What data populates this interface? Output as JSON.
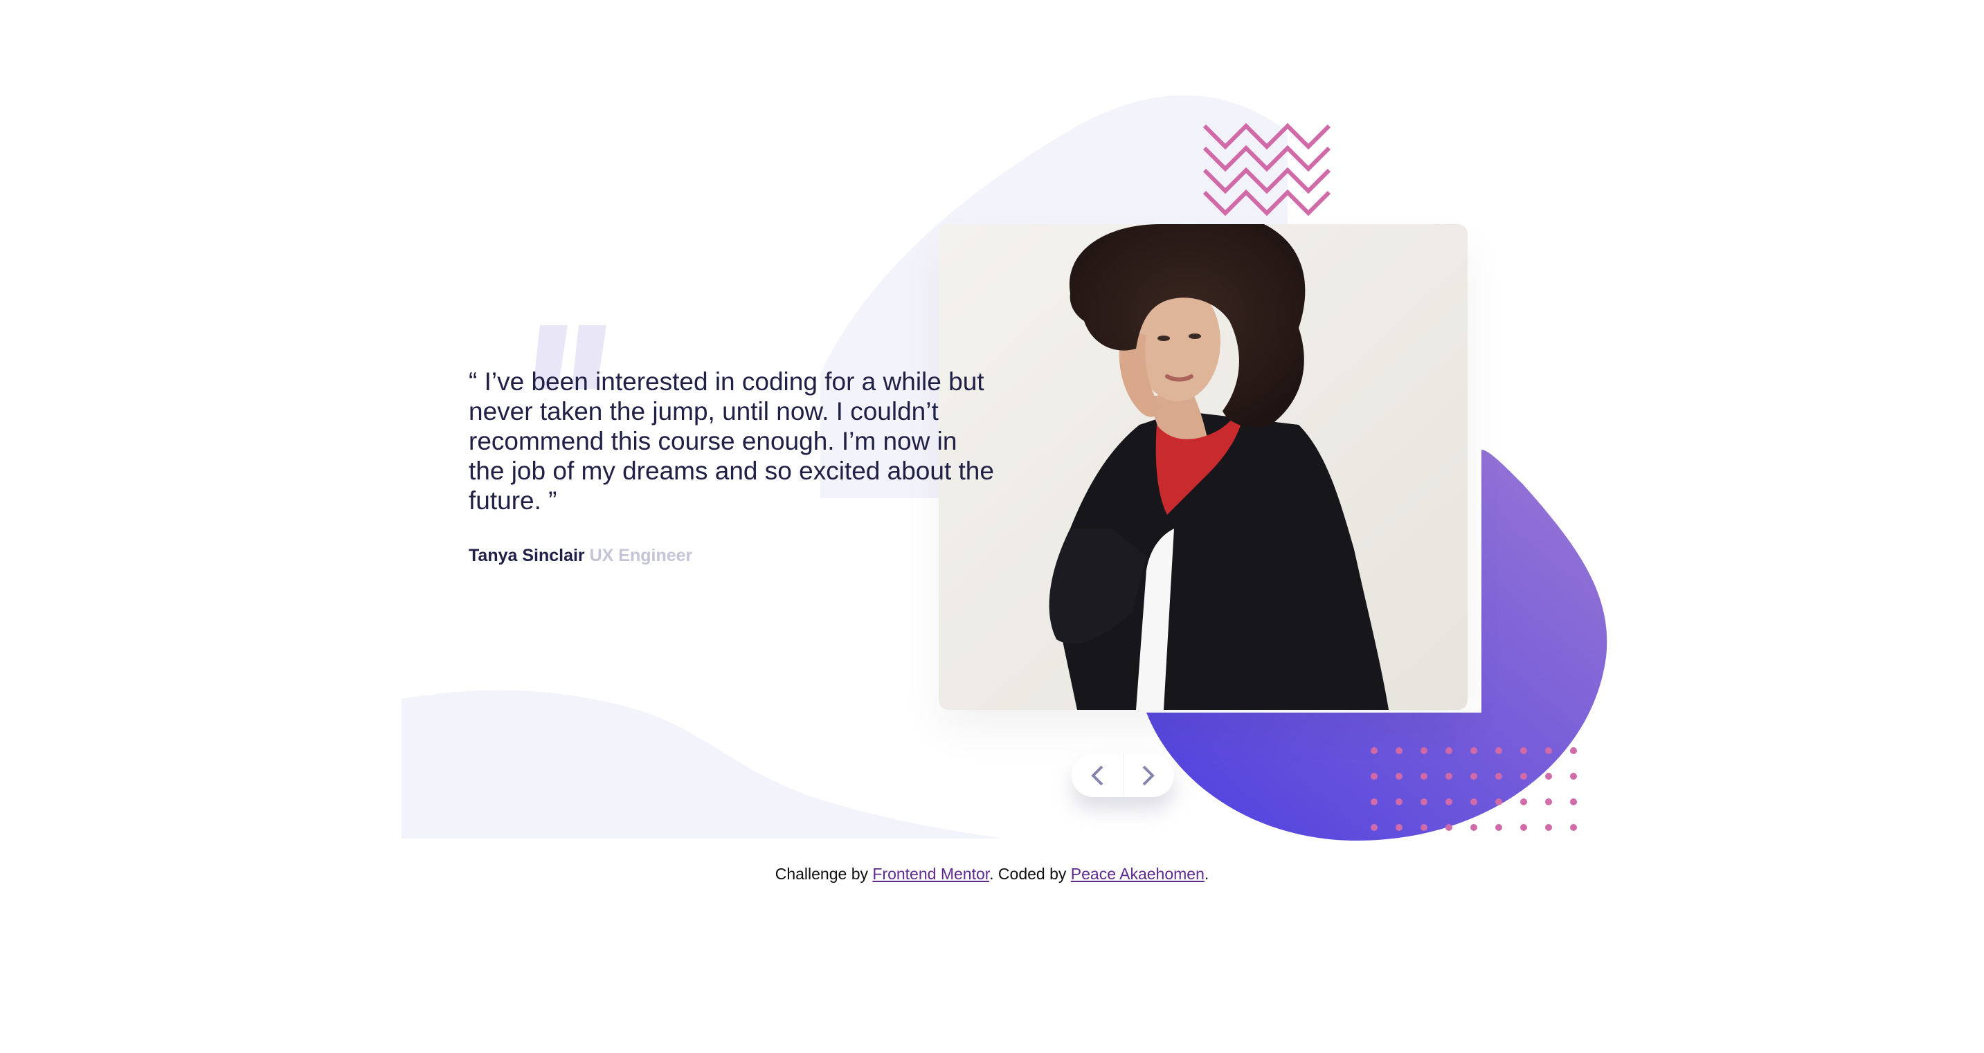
{
  "testimonial": {
    "quote": "“ I’ve been interested in coding for a while but never taken the jump, until now. I couldn’t recommend this course enough. I’m now in the job of my dreams and so excited about the future. ”",
    "author_name": "Tanya Sinclair",
    "author_role": "UX Engineer"
  },
  "navigation": {
    "prev_icon": "chevron-left-icon",
    "next_icon": "chevron-right-icon"
  },
  "attribution": {
    "prefix": "Challenge by ",
    "challenge_link": "Frontend Mentor",
    "middle": ". Coded by ",
    "author_link": "Peace Akaehomen",
    "suffix": "."
  },
  "colors": {
    "dark_navy": "#202046",
    "grayish_blue": "#c4c4d7",
    "light_lavender": "#f3f3fb",
    "purple_start": "#4c3fdf",
    "purple_end": "#9b78d4",
    "pink_pattern": "#d06aa8",
    "nav_icon": "#8585ac"
  }
}
